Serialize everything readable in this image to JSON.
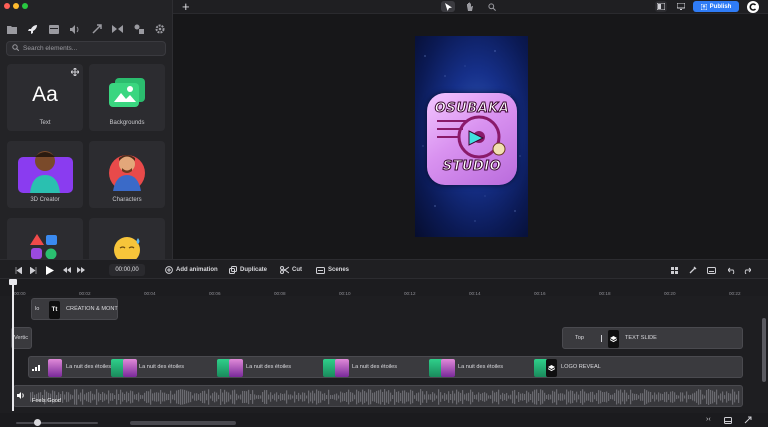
{
  "window": {
    "traffic_colors": [
      "#ff5f57",
      "#febc2e",
      "#28c840"
    ]
  },
  "sidebar": {
    "tools": [
      "folder-icon",
      "rocket-icon",
      "layout-icon",
      "audio-icon",
      "transition-icon",
      "bowtie-icon",
      "shapes-icon",
      "gear-icon"
    ],
    "search_placeholder": "Search elements...",
    "cards": [
      {
        "label": "Text",
        "glyph": "Aa"
      },
      {
        "label": "Backgrounds"
      },
      {
        "label": "3D Creator"
      },
      {
        "label": "Characters"
      },
      {
        "label": ""
      },
      {
        "label": ""
      }
    ]
  },
  "topbar": {
    "publish_label": "Publish",
    "accent": "#2f7cf6",
    "add_glyph": "+"
  },
  "canvas": {
    "logo_line1": "OSUBAKA",
    "logo_line2": "STUDIO"
  },
  "timeline_toolbar": {
    "timecode": "00:00,00",
    "add_animation": "Add animation",
    "duplicate": "Duplicate",
    "cut": "Cut",
    "scenes": "Scenes"
  },
  "ruler": {
    "ticks": [
      "00:00",
      "00:02",
      "00:04",
      "00:06",
      "00:08",
      "00:10",
      "00:12",
      "00:14",
      "00:16",
      "00:18",
      "00:20",
      "00:22"
    ]
  },
  "tracks": {
    "title_clip": {
      "prefix": "lo",
      "badge": "Tt",
      "label": "CRÉATION & MONT"
    },
    "vertic_clip": "Vertic",
    "top_clip": {
      "label": "Top",
      "slide": "TEXT SLIDE"
    },
    "music_clips": [
      "La nuit des étoiles",
      "La nuit des étoiles",
      "La nuit des étoiles",
      "La nuit des étoiles",
      "La nuit des étoiles"
    ],
    "logo_reveal": "LOGO REVEAL",
    "audio_label": "Feels Good"
  }
}
